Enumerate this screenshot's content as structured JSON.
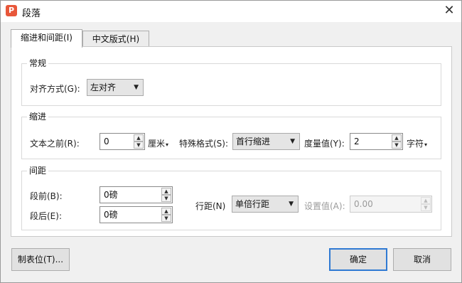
{
  "dialog": {
    "title": "段落",
    "app_icon_letter": "P",
    "close_symbol": "✕"
  },
  "tabs": [
    {
      "label": "缩进和间距(I)",
      "active": true
    },
    {
      "label": "中文版式(H)",
      "active": false
    }
  ],
  "general": {
    "title": "常规",
    "alignment_label": "对齐方式(G):",
    "alignment_value": "左对齐"
  },
  "indent": {
    "title": "缩进",
    "before_text_label": "文本之前(R):",
    "before_text_value": "0",
    "before_text_unit": "厘米",
    "special_label": "特殊格式(S):",
    "special_value": "首行缩进",
    "measure_label": "度量值(Y):",
    "measure_value": "2",
    "measure_unit": "字符"
  },
  "spacing": {
    "title": "间距",
    "before_label": "段前(B):",
    "before_value": "0磅",
    "after_label": "段后(E):",
    "after_value": "0磅",
    "line_label": "行距(N)",
    "line_value": "单倍行距",
    "setting_label": "设置值(A):",
    "setting_value": "0.00"
  },
  "buttons": {
    "tabs_label": "制表位(T)...",
    "ok_label": "确定",
    "cancel_label": "取消"
  },
  "colors": {
    "accent": "#2f7ad3",
    "app_icon": "#e8573a"
  }
}
